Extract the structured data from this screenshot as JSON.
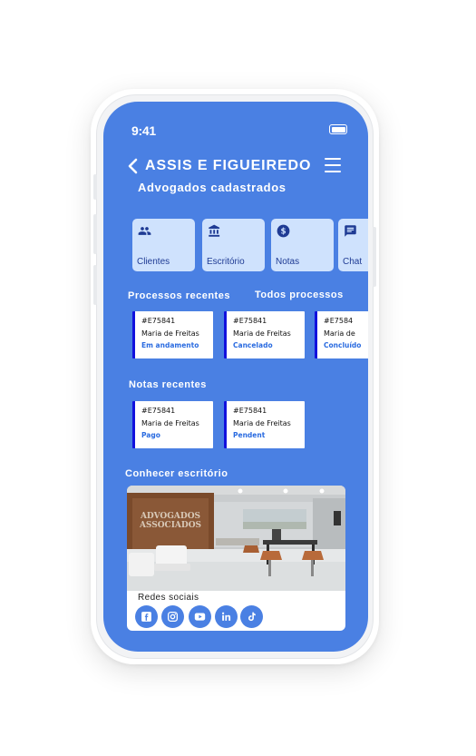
{
  "status_bar": {
    "time": "9:41"
  },
  "header": {
    "title": "ASSIS E FIGUEIREDO",
    "subtitle": "Advogados cadastrados"
  },
  "shortcuts": [
    {
      "label": "Clientes",
      "icon": "people-icon"
    },
    {
      "label": "Escritório",
      "icon": "bank-icon"
    },
    {
      "label": "Notas",
      "icon": "dollar-icon"
    },
    {
      "label": "Chat",
      "icon": "chat-icon"
    }
  ],
  "processes": {
    "title": "Processos recentes",
    "all_link": "Todos processos",
    "items": [
      {
        "id": "#E75841",
        "name": "Maria de Freitas",
        "status": "Em andamento"
      },
      {
        "id": "#E75841",
        "name": "Maria de Freitas",
        "status": "Cancelado"
      },
      {
        "id": "#E7584",
        "name": "Maria de",
        "status": "Concluído"
      }
    ]
  },
  "notes": {
    "title": "Notas recentes",
    "items": [
      {
        "id": "#E75841",
        "name": "Maria de Freitas",
        "status": "Pago"
      },
      {
        "id": "#E75841",
        "name": "Maria de Freitas",
        "status": "Pendent"
      }
    ]
  },
  "office": {
    "title": "Conhecer escritório",
    "sign_line1": "ADVOGADOS",
    "sign_line2": "ASSOCIADOS",
    "social_title": "Redes sociais",
    "social": [
      "facebook-icon",
      "instagram-icon",
      "youtube-icon",
      "linkedin-icon",
      "tiktok-icon"
    ]
  },
  "colors": {
    "screen_bg": "#4a80e3",
    "tile_bg": "#cfe2fd",
    "tile_text": "#1f3b94",
    "card_accent": "#1111dd",
    "status_text": "#2a6be0"
  }
}
